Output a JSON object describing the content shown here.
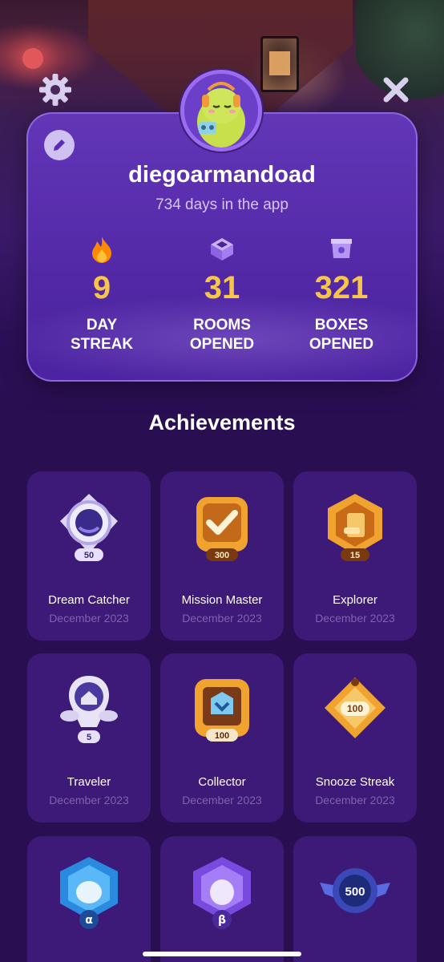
{
  "profile": {
    "username": "diegoarmandoad",
    "days_in_app": "734 days in the app"
  },
  "stats": [
    {
      "icon": "fire-icon",
      "value": "9",
      "label_line1": "DAY",
      "label_line2": "STREAK"
    },
    {
      "icon": "open-box-icon",
      "value": "31",
      "label_line1": "ROOMS",
      "label_line2": "OPENED"
    },
    {
      "icon": "box-icon",
      "value": "321",
      "label_line1": "BOXES",
      "label_line2": "OPENED"
    }
  ],
  "achievements_title": "Achievements",
  "achievements": [
    {
      "name": "Dream Catcher",
      "date": "December 2023",
      "badge_count": "50",
      "icon": "dream-catcher-badge-icon"
    },
    {
      "name": "Mission Master",
      "date": "December 2023",
      "badge_count": "300",
      "icon": "mission-master-badge-icon"
    },
    {
      "name": "Explorer",
      "date": "December 2023",
      "badge_count": "15",
      "icon": "explorer-badge-icon"
    },
    {
      "name": "Traveler",
      "date": "December 2023",
      "badge_count": "5",
      "icon": "traveler-badge-icon"
    },
    {
      "name": "Collector",
      "date": "December 2023",
      "badge_count": "100",
      "icon": "collector-badge-icon"
    },
    {
      "name": "Snooze Streak",
      "date": "December 2023",
      "badge_count": "100",
      "icon": "snooze-streak-badge-icon"
    },
    {
      "name": "",
      "date": "",
      "badge_count": "",
      "icon": "alpha-badge-icon"
    },
    {
      "name": "",
      "date": "",
      "badge_count": "",
      "icon": "beta-badge-icon"
    },
    {
      "name": "",
      "date": "",
      "badge_count": "500",
      "icon": "winged-500-badge-icon"
    }
  ],
  "colors": {
    "background": "#2a0e52",
    "card": "#3d1978",
    "profile_card": "#5a2cb4",
    "accent_gold": "#f7c54a",
    "muted_text": "#7e63ad"
  }
}
